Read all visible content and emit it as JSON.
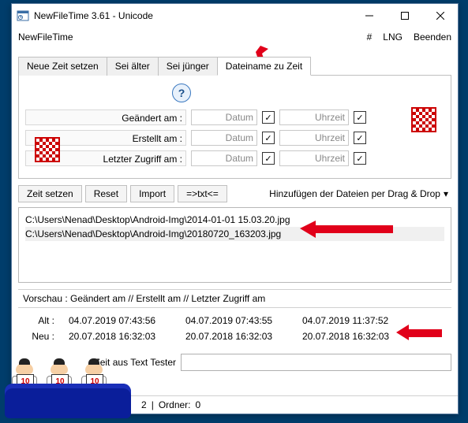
{
  "window": {
    "title": "NewFileTime 3.61 - Unicode"
  },
  "menubar": {
    "app": "NewFileTime",
    "hash": "#",
    "lng": "LNG",
    "exit": "Beenden"
  },
  "tabs": [
    "Neue Zeit setzen",
    "Sei älter",
    "Sei jünger",
    "Dateiname zu Zeit"
  ],
  "active_tab": 3,
  "help_glyph": "?",
  "rows": {
    "modified": {
      "label": "Geändert am :",
      "date": "Datum",
      "time": "Uhrzeit"
    },
    "created": {
      "label": "Erstellt am :",
      "date": "Datum",
      "time": "Uhrzeit"
    },
    "accessed": {
      "label": "Letzter Zugriff am :",
      "date": "Datum",
      "time": "Uhrzeit"
    }
  },
  "check_glyph": "✓",
  "actions": {
    "set_time": "Zeit setzen",
    "reset": "Reset",
    "import": "Import",
    "txt": "=>txt<=",
    "drag": "Hinzufügen der Dateien per Drag & Drop",
    "caret": "▾"
  },
  "files": [
    "C:\\Users\\Nenad\\Desktop\\Android-Img\\2014-01-01 15.03.20.jpg",
    "C:\\Users\\Nenad\\Desktop\\Android-Img\\20180720_163203.jpg"
  ],
  "preview": {
    "header": "Vorschau :   Geändert am    //    Erstellt am    //    Letzter Zugriff am",
    "alt_label": "Alt :",
    "neu_label": "Neu :",
    "alt": [
      "04.07.2019 07:43:56",
      "04.07.2019 07:43:55",
      "04.07.2019 11:37:52"
    ],
    "neu": [
      "20.07.2018 16:32:03",
      "20.07.2018 16:32:03",
      "20.07.2018 16:32:03"
    ]
  },
  "text_tester": {
    "label": "Zeit aus Text Tester",
    "value": ""
  },
  "status": {
    "files": "2",
    "folders_label": "Ordner:",
    "folders": "0"
  },
  "judge_score": "10"
}
